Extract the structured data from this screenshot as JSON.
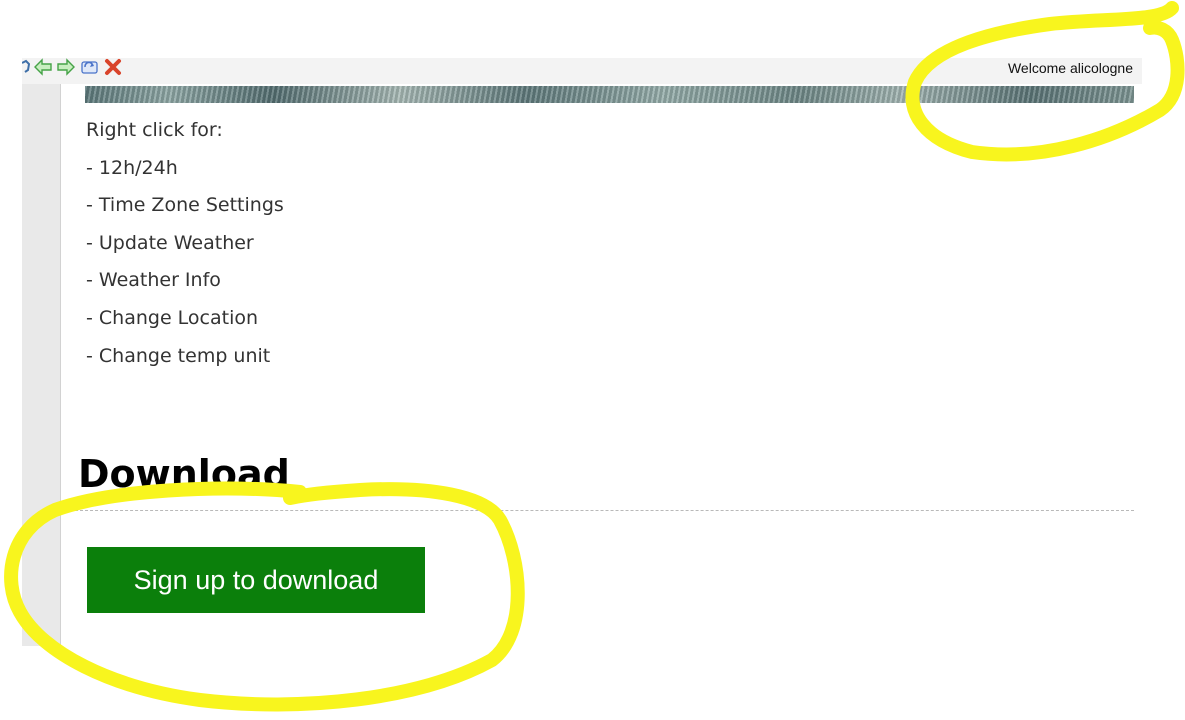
{
  "header": {
    "welcome_text": "Welcome alicologne",
    "nav_icons": [
      "page-icon",
      "back-arrow-icon",
      "forward-arrow-icon",
      "refresh-icon",
      "close-icon"
    ]
  },
  "instructions": {
    "intro": "Right click for:",
    "items": [
      "- 12h/24h",
      "- Time Zone Settings",
      "- Update Weather",
      "- Weather Info",
      "- Change Location",
      "- Change temp unit"
    ]
  },
  "download": {
    "heading": "Download",
    "button_label": "Sign up to download",
    "button_color": "#0b7f0b"
  },
  "annotations": {
    "highlight_color": "#f8f51e"
  }
}
